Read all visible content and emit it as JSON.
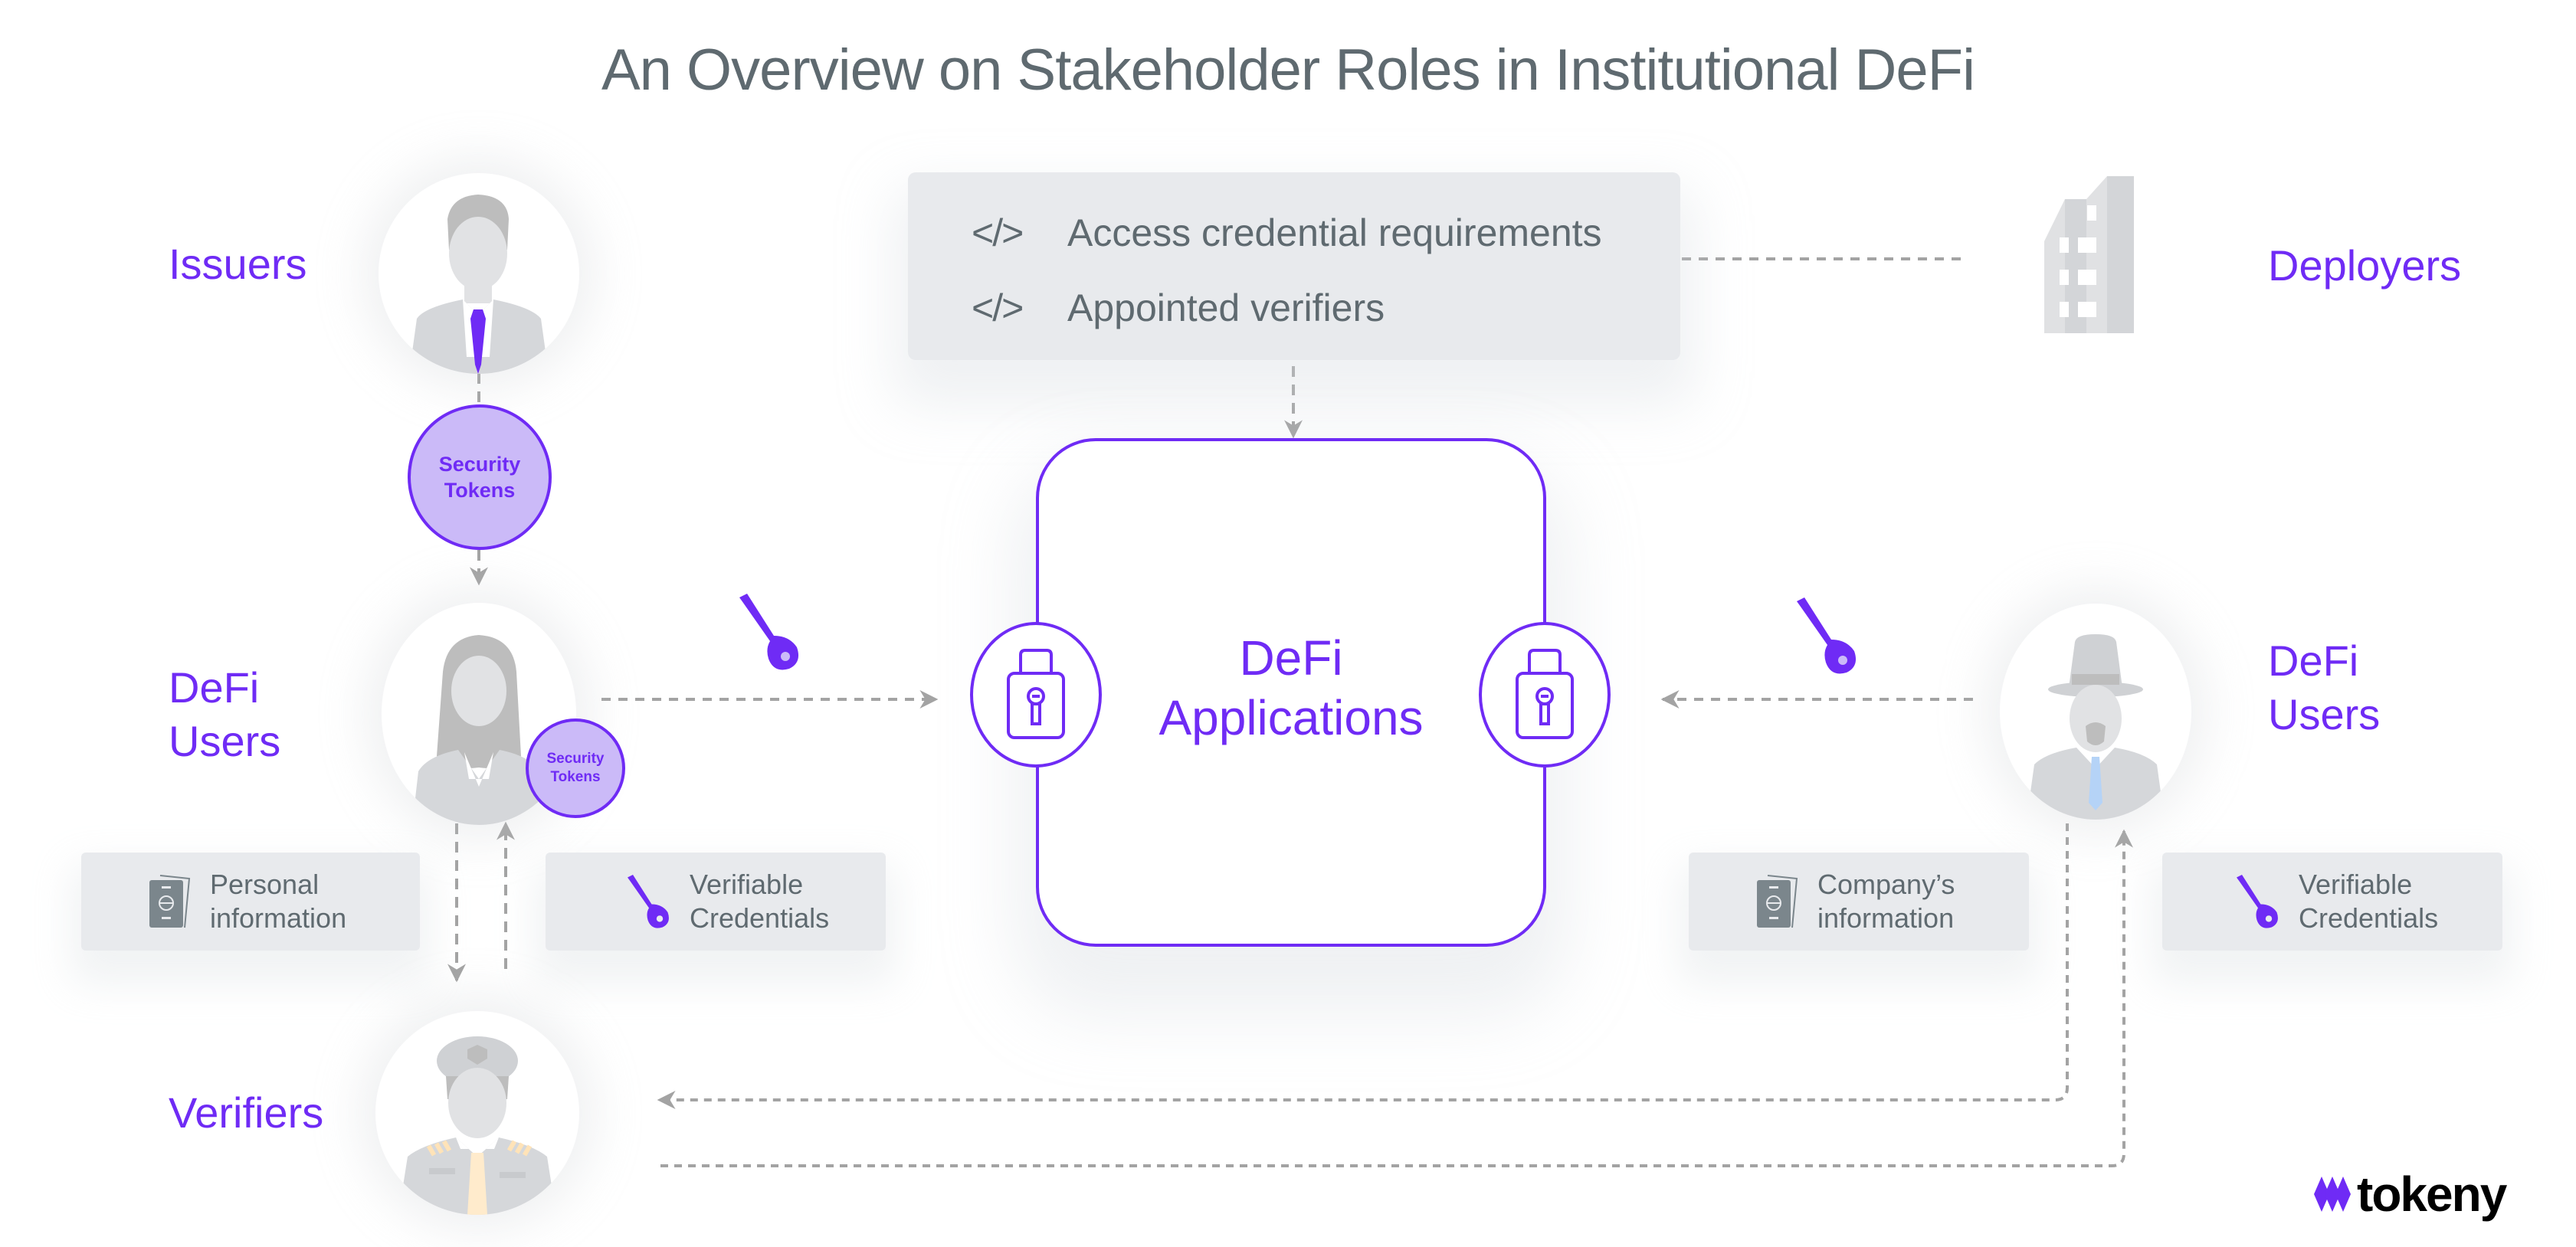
{
  "title": "An Overview on Stakeholder Roles in Institutional DeFi",
  "roles": {
    "issuers": "Issuers",
    "deployers": "Deployers",
    "defi_users_left_line1": "DeFi",
    "defi_users_left_line2": "Users",
    "defi_users_right_line1": "DeFi",
    "defi_users_right_line2": "Users",
    "verifiers": "Verifiers"
  },
  "requirements": {
    "items": [
      {
        "icon": "code-icon",
        "symbol": "</>",
        "label": "Access credential requirements"
      },
      {
        "icon": "code-icon",
        "symbol": "</>",
        "label": "Appointed verifiers"
      }
    ]
  },
  "defi_applications": {
    "line1": "DeFi",
    "line2": "Applications"
  },
  "security_tokens": {
    "line1": "Security",
    "line2": "Tokens"
  },
  "info_boxes": {
    "personal": {
      "line1": "Personal",
      "line2": "information",
      "icon": "passport-icon"
    },
    "vc_left": {
      "line1": "Verifiable",
      "line2": "Credentials",
      "icon": "key-icon"
    },
    "company": {
      "line1": "Company’s",
      "line2": "information",
      "icon": "passport-icon"
    },
    "vc_right": {
      "line1": "Verifiable",
      "line2": "Credentials",
      "icon": "key-icon"
    }
  },
  "brand": {
    "name": "tokeny",
    "accent": "#6f2bf5",
    "token_fill": "#cbbaf8",
    "text_gray": "#5f6a70",
    "box_gray": "#e8eaed",
    "line_gray": "#a3a3a3"
  }
}
